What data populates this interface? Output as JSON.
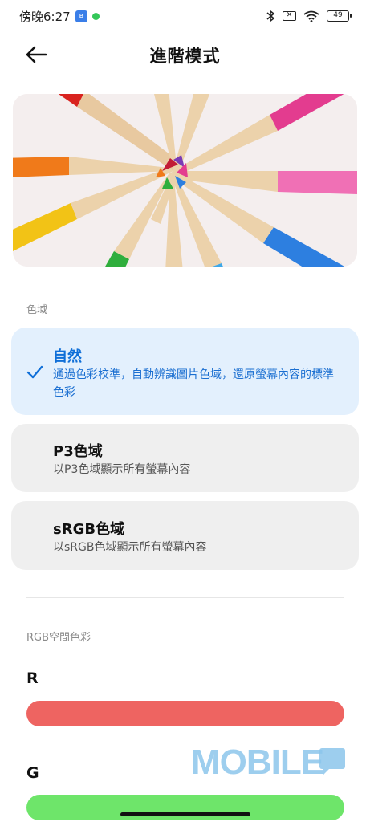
{
  "status_bar": {
    "time": "傍晚6:27",
    "sim_label": "✕",
    "battery": "49",
    "bluetooth_icon": "bluetooth-icon",
    "wifi_icon": "wifi-icon"
  },
  "header": {
    "title": "進階模式",
    "back_icon": "arrow-left-icon"
  },
  "hero_image": {
    "subject": "colored pencils arranged in a circle",
    "icon": "hero-image"
  },
  "gamut": {
    "section_label": "色域",
    "options": [
      {
        "title": "自然",
        "description": "通過色彩校準，自動辨識圖片色域，還原螢幕內容的標準色彩",
        "selected": true
      },
      {
        "title": "P3色域",
        "description": "以P3色域顯示所有螢幕內容",
        "selected": false
      },
      {
        "title": "sRGB色域",
        "description": "以sRGB色域顯示所有螢幕內容",
        "selected": false
      }
    ]
  },
  "rgb": {
    "section_label": "RGB空間色彩",
    "channels": [
      {
        "label": "R",
        "color": "#ee6461"
      },
      {
        "label": "G",
        "color": "#6ee56a"
      }
    ]
  },
  "watermark": {
    "text": "MOBILE"
  },
  "colors": {
    "accent": "#0f6fd8",
    "selected_bg": "#e3f0fd",
    "option_bg": "#efefef",
    "red_slider": "#ee6461",
    "green_slider": "#6ee56a"
  }
}
